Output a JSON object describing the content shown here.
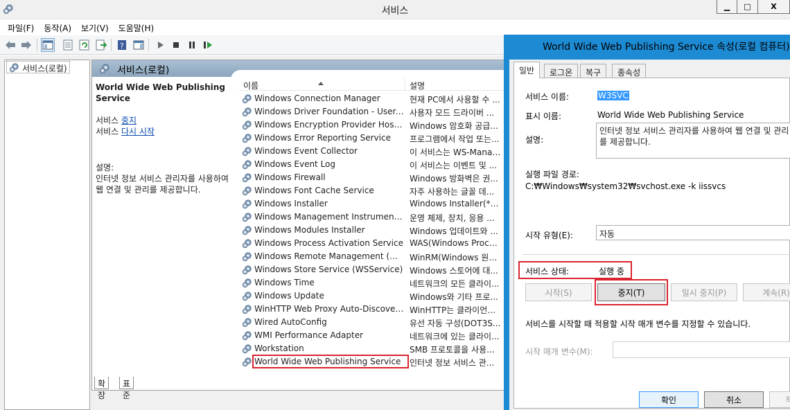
{
  "window": {
    "title": "서비스",
    "buttons": [
      "▁",
      "□",
      "X"
    ]
  },
  "menu": [
    "파일(F)",
    "동작(A)",
    "보기(V)",
    "도움말(H)"
  ],
  "toolbar_icons": [
    "back-icon",
    "forward-icon",
    "console-tree-icon",
    "properties-icon",
    "refresh-icon",
    "export-list-icon",
    "help-icon",
    "show-hide-action-pane-icon",
    "start-icon",
    "stop-icon",
    "pause-icon",
    "restart-icon"
  ],
  "tree": {
    "root": "서비스(로컬)"
  },
  "pane": {
    "title": "서비스(로컬)",
    "selected_name": "World Wide Web Publishing Service",
    "action1_prefix": "서비스 ",
    "action1_link": "중지",
    "action2_prefix": "서비스 ",
    "action2_link": "다시 시작",
    "desc_label": "설명:",
    "desc_text": "인터넷 정보 서비스 관리자를 사용하여 웹 연결 및 관리를 제공합니다."
  },
  "list": {
    "columns": [
      "이름",
      "설명"
    ],
    "rows": [
      {
        "name": "Windows Connection Manager",
        "desc": "현재 PC에서 사용할 수 ..."
      },
      {
        "name": "Windows Driver Foundation - User-m...",
        "desc": "사용자 모드 드라이버 ..."
      },
      {
        "name": "Windows Encryption Provider Host Se...",
        "desc": "Windows 암호화 공급..."
      },
      {
        "name": "Windows Error Reporting Service",
        "desc": "프로그램에서 작업 또는..."
      },
      {
        "name": "Windows Event Collector",
        "desc": "이 서비스는 WS-Manag..."
      },
      {
        "name": "Windows Event Log",
        "desc": "이 서비스는 이벤트 및 ..."
      },
      {
        "name": "Windows Firewall",
        "desc": "Windows 방화벽은 권..."
      },
      {
        "name": "Windows Font Cache Service",
        "desc": "자주 사용하는 글꼴 데..."
      },
      {
        "name": "Windows Installer",
        "desc": "Windows Installer(*.msi,..."
      },
      {
        "name": "Windows Management Instrumentation",
        "desc": "운영 체제, 장치, 응용 ..."
      },
      {
        "name": "Windows Modules Installer",
        "desc": "Windows 업데이트와 ..."
      },
      {
        "name": "Windows Process Activation Service",
        "desc": "WAS(Windows Process ..."
      },
      {
        "name": "Windows Remote Management (WS-...",
        "desc": "WinRM(Windows 원격 ..."
      },
      {
        "name": "Windows Store Service (WSService)",
        "desc": "Windows 스토어에 대..."
      },
      {
        "name": "Windows Time",
        "desc": "네트워크의 모든 클라이..."
      },
      {
        "name": "Windows Update",
        "desc": "Windows와 기타 프로..."
      },
      {
        "name": "WinHTTP Web Proxy Auto-Discovery ...",
        "desc": "WinHTTP는 클라이언트..."
      },
      {
        "name": "Wired AutoConfig",
        "desc": "유선 자동 구성(DOT3S..."
      },
      {
        "name": "WMI Performance Adapter",
        "desc": "네트워크에 있는 클라이..."
      },
      {
        "name": "Workstation",
        "desc": "SMB 프로토콜을 사용..."
      },
      {
        "name": "World Wide Web Publishing Service",
        "desc": "인터넷 정보 서비스 관..."
      }
    ]
  },
  "bottom_tabs": [
    "확장",
    "표준"
  ],
  "dialog": {
    "title": "World Wide Web Publishing Service 속성(로컬 컴퓨터)",
    "tabs": [
      "일반",
      "로그온",
      "복구",
      "종속성"
    ],
    "service_name_label": "서비스 이름:",
    "service_name": "W3SVC",
    "display_name_label": "표시 이름:",
    "display_name": "World Wide Web Publishing Service",
    "desc_label": "설명:",
    "desc_text": "인터넷 정보 서비스 관리자를 사용하여 웹 연결 및 관리를 제공합니다.",
    "exe_path_label": "실행 파일 경로:",
    "exe_path": "C:₩Windows₩system32₩svchost.exe -k iissvcs",
    "startup_type_label": "시작 유형(E):",
    "startup_type": "자동",
    "status_label": "서비스 상태:",
    "status": "실행 중",
    "btn_start": "시작(S)",
    "btn_stop": "중지(T)",
    "btn_pause": "일시 중지(P)",
    "btn_resume": "계속(R)",
    "hint": "서비스를 시작할 때 적용할 시작 매개 변수를 지정할 수 있습니다.",
    "params_label": "시작 매개 변수(M):",
    "btn_ok": "확인",
    "btn_cancel": "취소",
    "btn_apply": "적용(A)"
  },
  "colors": {
    "dialog_frame": "#1d8bd4",
    "highlight_red": "#d9232e",
    "selection_blue": "#3399ff"
  }
}
